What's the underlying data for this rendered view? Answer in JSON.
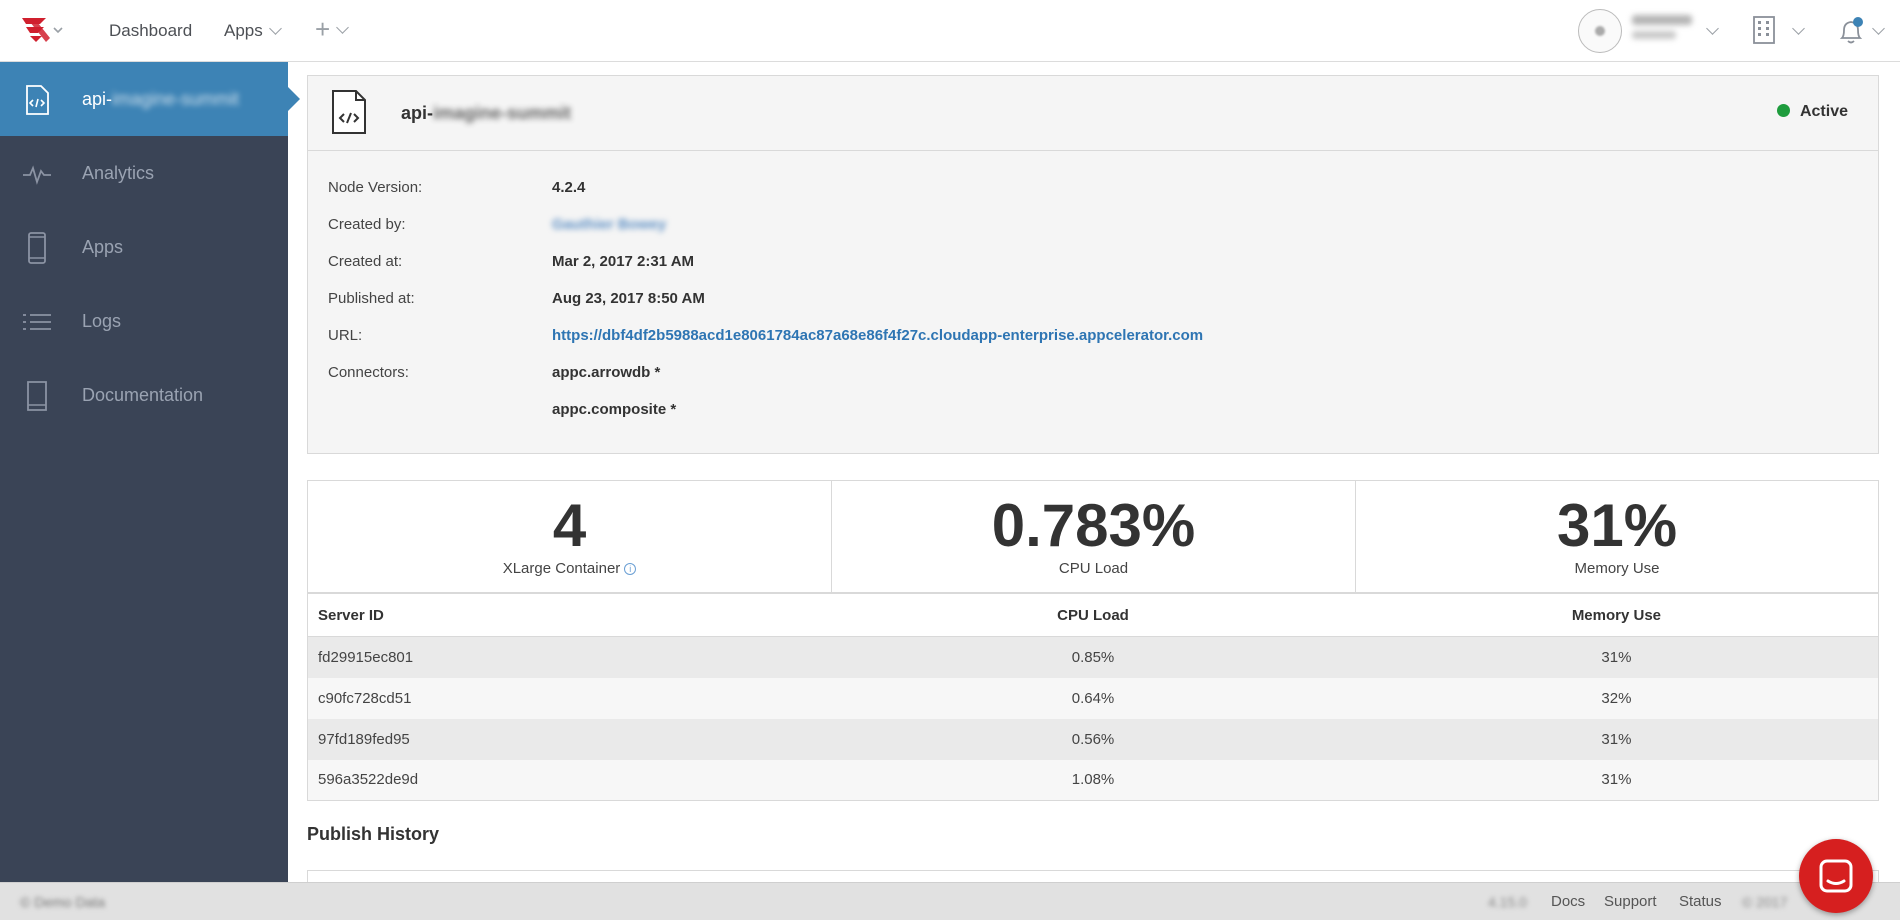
{
  "topbar": {
    "logo": "appcelerator-logo",
    "nav": [
      {
        "label": "Dashboard"
      },
      {
        "label": "Apps"
      }
    ],
    "create_icon": "plus-icon",
    "user": {
      "name": "Charles",
      "org": "Bowey"
    },
    "org_icon": "building-icon",
    "notifications_icon": "bell-icon",
    "colors": {
      "notification_dot": "#3d83b5"
    }
  },
  "sidebar": {
    "active_item": {
      "prefix": "api-",
      "rest": "imagine-summit",
      "icon": "code-file-icon"
    },
    "items": [
      {
        "label": "Analytics",
        "icon": "analytics-icon"
      },
      {
        "label": "Apps",
        "icon": "mobile-icon"
      },
      {
        "label": "Logs",
        "icon": "list-icon"
      },
      {
        "label": "Documentation",
        "icon": "book-icon"
      }
    ],
    "colors": {
      "background": "#3a4456",
      "active": "#3d83b5"
    }
  },
  "detail": {
    "name_prefix": "api-",
    "name_rest": "imagine-summit",
    "status": "Active",
    "status_color": "#1e9c3d",
    "fields": {
      "node_version_label": "Node Version:",
      "node_version": "4.2.4",
      "created_by_label": "Created by:",
      "created_by": "Gauthier Bowey",
      "created_at_label": "Created at:",
      "created_at": "Mar 2, 2017 2:31 AM",
      "published_at_label": "Published at:",
      "published_at": "Aug 23, 2017 8:50 AM",
      "url_label": "URL:",
      "url": "https://dbf4df2b5988acd1e8061784ac87a68e86f4f27c.cloudapp-enterprise.appcelerator.com",
      "connectors_label": "Connectors:",
      "connectors": [
        "appc.arrowdb *",
        "appc.composite *"
      ]
    }
  },
  "stats": [
    {
      "value": "4",
      "label": "XLarge Container"
    },
    {
      "value": "0.783%",
      "label": "CPU Load"
    },
    {
      "value": "31%",
      "label": "Memory Use"
    }
  ],
  "servers": {
    "headers": {
      "id": "Server ID",
      "cpu": "CPU Load",
      "mem": "Memory Use"
    },
    "rows": [
      {
        "id": "fd29915ec801",
        "cpu": "0.85%",
        "mem": "31%"
      },
      {
        "id": "c90fc728cd51",
        "cpu": "0.64%",
        "mem": "32%"
      },
      {
        "id": "97fd189fed95",
        "cpu": "0.56%",
        "mem": "31%"
      },
      {
        "id": "596a3522de9d",
        "cpu": "1.08%",
        "mem": "31%"
      }
    ]
  },
  "publish_history": {
    "title": "Publish History"
  },
  "footer": {
    "left": "© Demo Data",
    "version": "4.15.0",
    "links": [
      "Docs",
      "Support",
      "Status"
    ],
    "copyright": "© 2017"
  },
  "chat": {
    "icon": "chat-icon",
    "color": "#d61f1f"
  }
}
